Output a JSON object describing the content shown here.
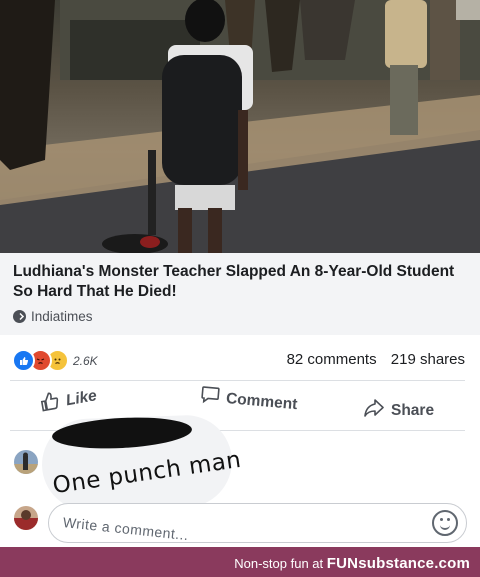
{
  "post": {
    "link_preview": {
      "headline": "Ludhiana's Monster Teacher Slapped An 8-Year-Old Student So Hard That He Died!",
      "source": "Indiatimes",
      "source_icon": "check-circle-icon"
    },
    "reactions": {
      "icons": [
        "like-reaction-icon",
        "angry-reaction-icon",
        "sad-reaction-icon"
      ],
      "count": "2.6K"
    },
    "comments_count": "82 comments",
    "shares_count": "219 shares",
    "actions": {
      "like_label": "Like",
      "comment_label": "Comment",
      "share_label": "Share"
    }
  },
  "comment": {
    "text": "One punch man"
  },
  "composer": {
    "placeholder": "Write a comment...",
    "emoji_icon": "smiley-icon"
  },
  "footer": {
    "prefix": "Non-stop fun at",
    "brand": "FUNsubstance.com",
    "background": "#8a3a5d"
  },
  "colors": {
    "reaction_like": "#1877f2",
    "reaction_angry": "#e0492f",
    "reaction_sad": "#f5c33b"
  }
}
